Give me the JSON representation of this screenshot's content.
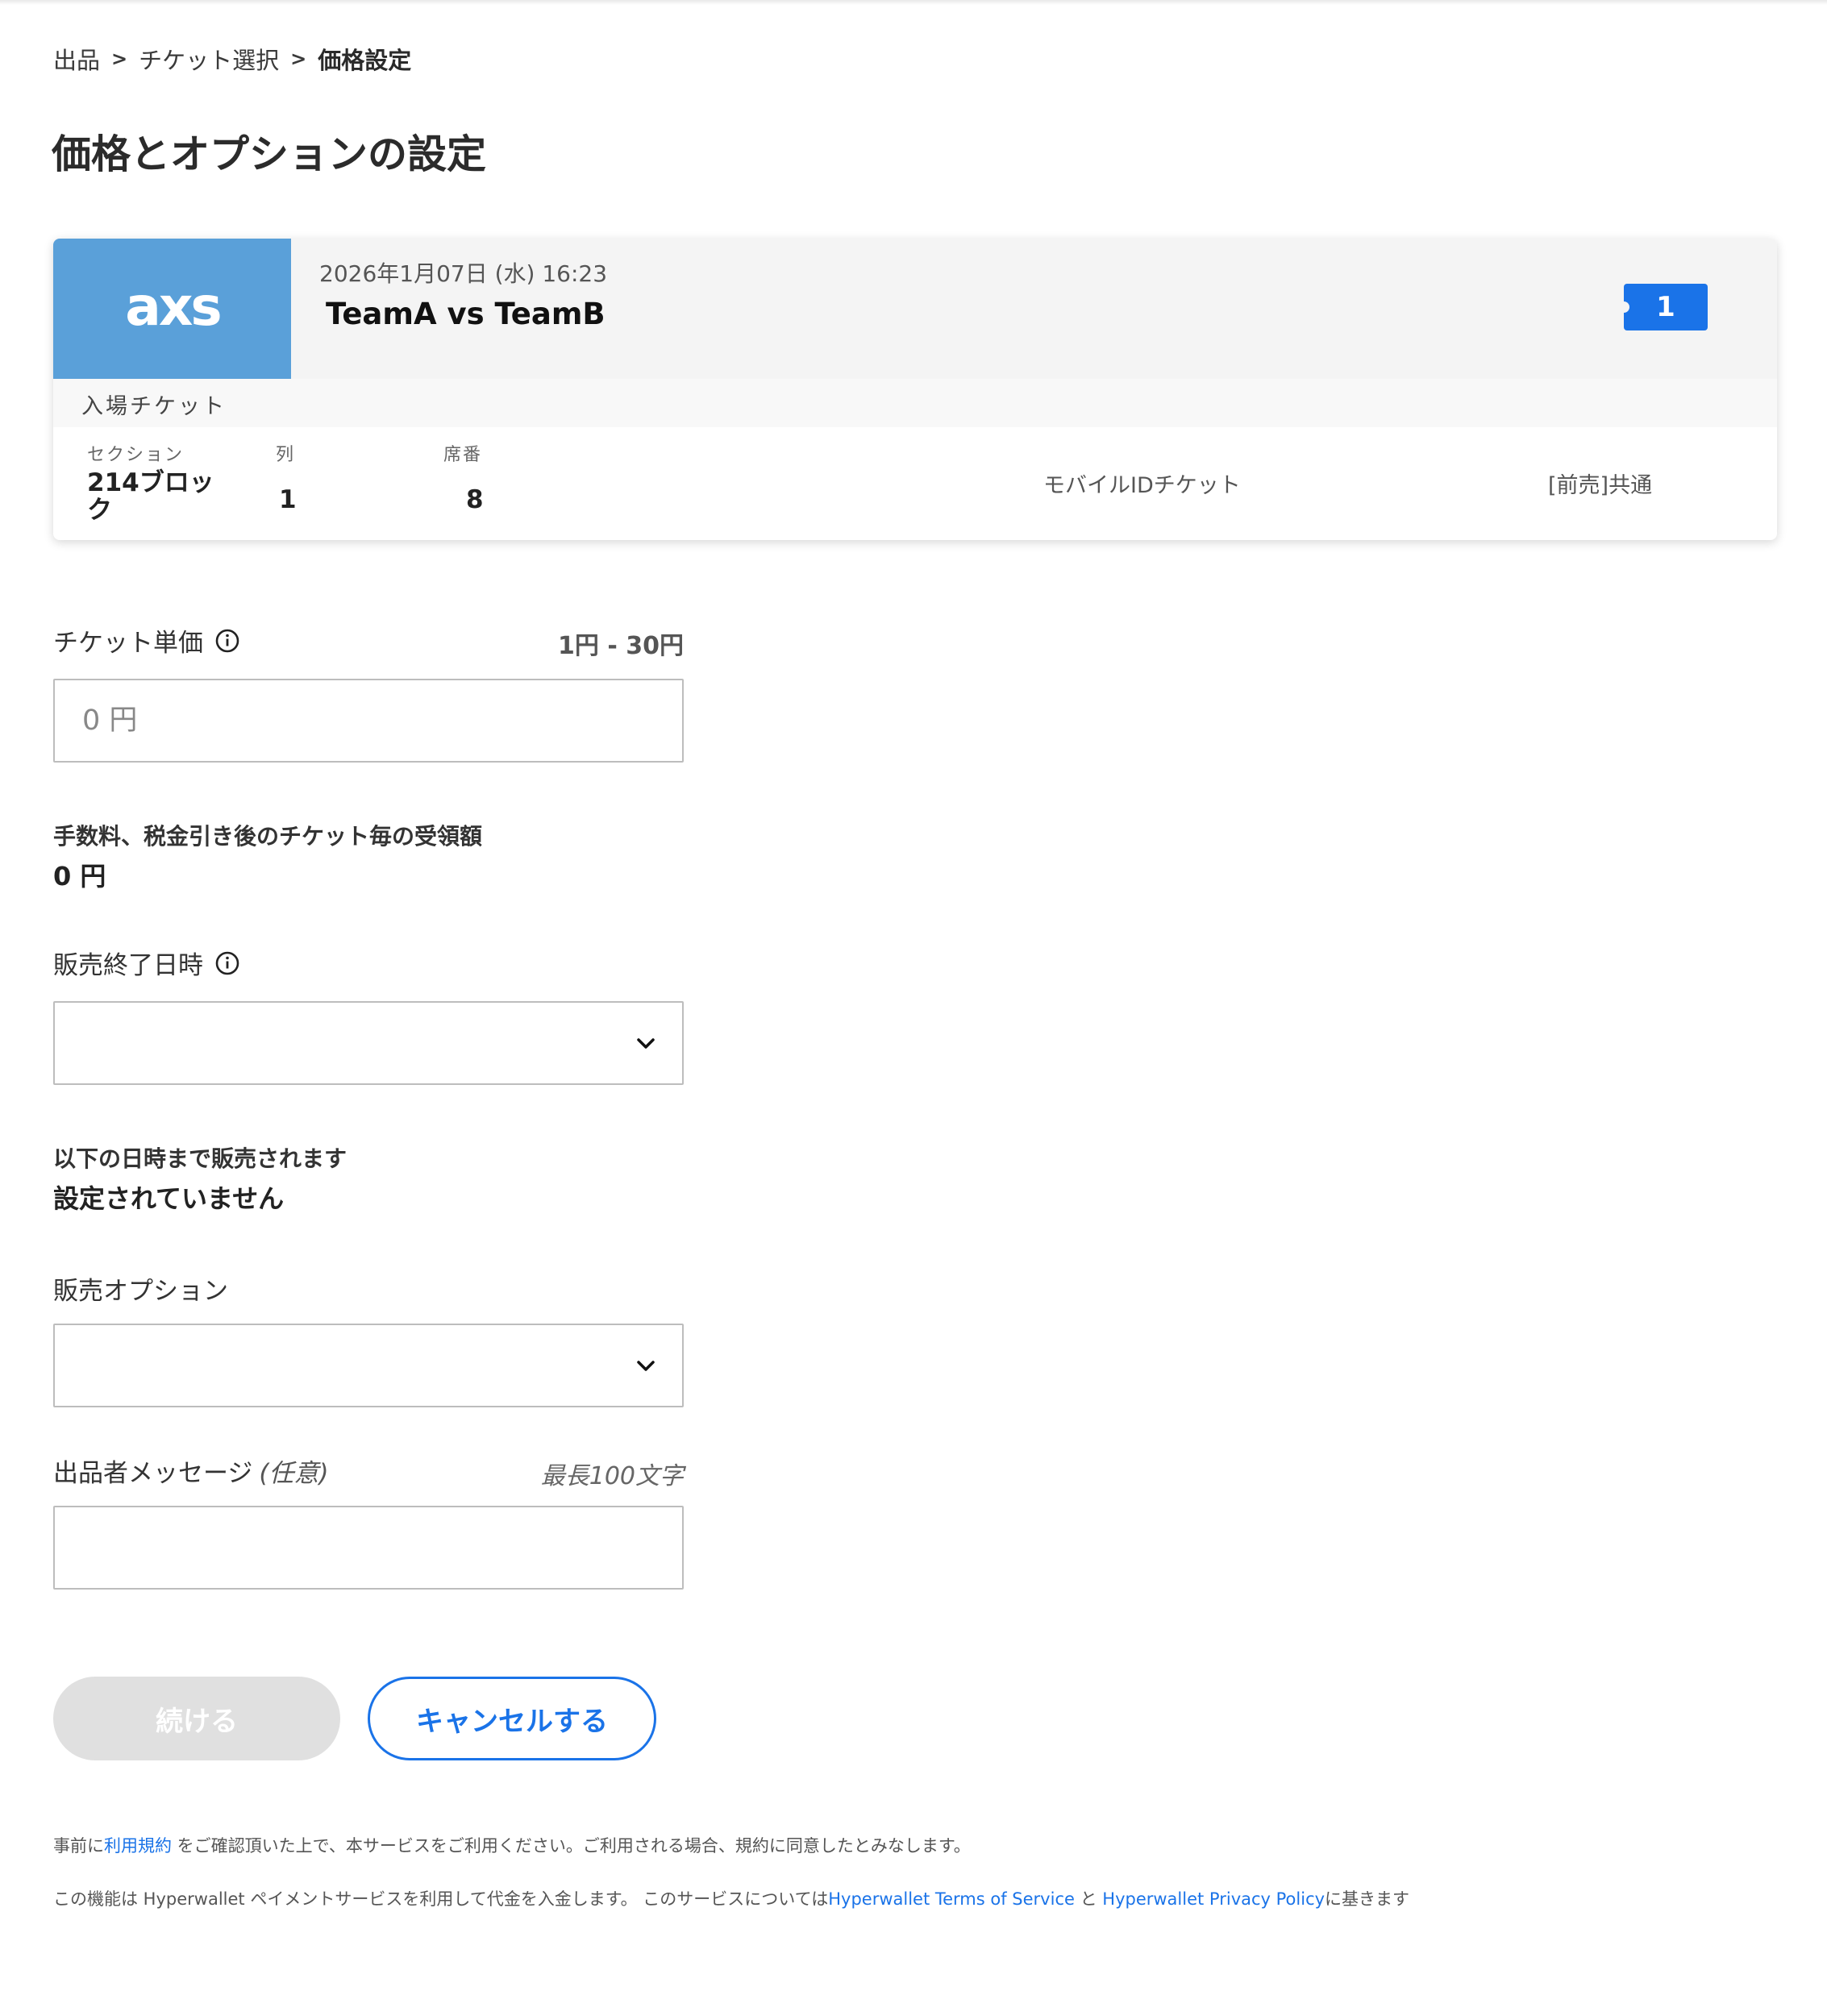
{
  "breadcrumb": {
    "items": [
      "出品",
      "チケット選択"
    ],
    "separator": ">",
    "current": "価格設定"
  },
  "page_title": "価格とオプションの設定",
  "event": {
    "logo_text": "axs",
    "logo_bg": "#5aa0d9",
    "date": "2026年1月07日 (水) 16:23",
    "name": "TeamA vs TeamB",
    "quantity": "1",
    "ticket_type": "入場チケット",
    "columns": {
      "section_label": "セクション",
      "row_label": "列",
      "seat_label": "席番",
      "section_value_line1": "214ブロッ",
      "section_value_line2": "ク",
      "row_value": "1",
      "seat_value": "8"
    },
    "delivery": "モバイルIDチケット",
    "sale_type": "[前売]共通",
    "icons": [
      "ticket-badge-icon",
      "chevron-up-icon"
    ]
  },
  "form": {
    "price_label": "チケット単価",
    "price_range": "1円 - 30円",
    "price_placeholder": "0 円",
    "net_label": "手数料、税金引き後のチケット毎の受領額",
    "net_value": "0 円",
    "end_label": "販売終了日時",
    "end_note_label": "以下の日時まで販売されます",
    "end_note_value": "設定されていません",
    "option_label": "販売オプション",
    "message_label": "出品者メッセージ",
    "message_optional": "(任意)",
    "message_max": "最長100文字"
  },
  "buttons": {
    "continue": "続ける",
    "cancel": "キャンセルする"
  },
  "footer": {
    "line1_prefix": "事前に",
    "line1_link": "利用規約",
    "line1_suffix": " をご確認頂いた上で、本サービスをご利用ください。ご利用される場合、規約に同意したとみなします。",
    "line2_prefix": "この機能は Hyperwallet ペイメントサービスを利用して代金を入金します。 このサービスについては",
    "line2_link1": "Hyperwallet Terms of Service",
    "line2_mid": " と ",
    "line2_link2": "Hyperwallet Privacy Policy",
    "line2_suffix": "に基きます"
  },
  "colors": {
    "accent": "#1a73e8",
    "disabled_button": "#e0e0e0"
  }
}
